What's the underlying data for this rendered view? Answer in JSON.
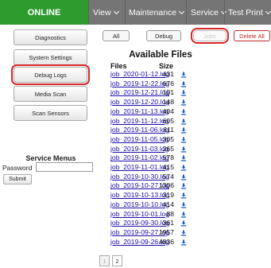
{
  "nav": {
    "brand": "ONLINE",
    "items": [
      {
        "label": "View"
      },
      {
        "label": "Maintenance"
      },
      {
        "label": "Service"
      },
      {
        "label": "Test Print"
      }
    ]
  },
  "sidebar": {
    "buttons": [
      {
        "label": "Diagnostics"
      },
      {
        "label": "System Settings"
      },
      {
        "label": "Debug Logs",
        "active": true
      },
      {
        "label": "Media Scan"
      },
      {
        "label": "Scan Sensors"
      }
    ],
    "service_menus": {
      "title": "Service Menus",
      "password_label": "Password",
      "password_value": "",
      "submit_label": "Submit"
    }
  },
  "filters": {
    "all_label": "All",
    "debug_label": "Debug",
    "jobs_label": "Jobs",
    "delete_all_label": "Delete All"
  },
  "files": {
    "title": "Available Files",
    "col_files": "Files",
    "col_size": "Size",
    "rows": [
      {
        "name": "job_2020-01-12.log",
        "size": "431"
      },
      {
        "name": "job_2019-12-22.log",
        "size": "676"
      },
      {
        "name": "job_2019-12-21.log",
        "size": "101"
      },
      {
        "name": "job_2019-12-20.log",
        "size": "148"
      },
      {
        "name": "job_2019-11-13.log",
        "size": "404"
      },
      {
        "name": "job_2019-11-12.log",
        "size": "605"
      },
      {
        "name": "job_2019-11-06.log",
        "size": "811"
      },
      {
        "name": "job_2019-11-05.log",
        "size": "305"
      },
      {
        "name": "job_2019-11-03.log",
        "size": "265"
      },
      {
        "name": "job_2019-11-02.log",
        "size": "578"
      },
      {
        "name": "job_2019-11-01.log",
        "size": "415"
      },
      {
        "name": "job_2019-10-30.log",
        "size": "574"
      },
      {
        "name": "job_2019-10-27.log",
        "size": "1306"
      },
      {
        "name": "job_2019-10-13.log",
        "size": "319"
      },
      {
        "name": "job_2019-10-10.log",
        "size": "414"
      },
      {
        "name": "job_2019-10-01.log",
        "size": "88"
      },
      {
        "name": "job_2019-09-30.log",
        "size": "361"
      },
      {
        "name": "job_2019-09-27.log",
        "size": "1957"
      },
      {
        "name": "job_2019-09-26.log",
        "size": "4836"
      }
    ],
    "download_icon": "download-icon"
  },
  "pagination": {
    "pages": [
      "1",
      "2"
    ],
    "current": "1"
  },
  "colors": {
    "brand": "#2e9b2e",
    "nav": "#757575",
    "highlight": "#d42828",
    "link": "#1a0dab",
    "download_icon": "#1e63c4"
  }
}
